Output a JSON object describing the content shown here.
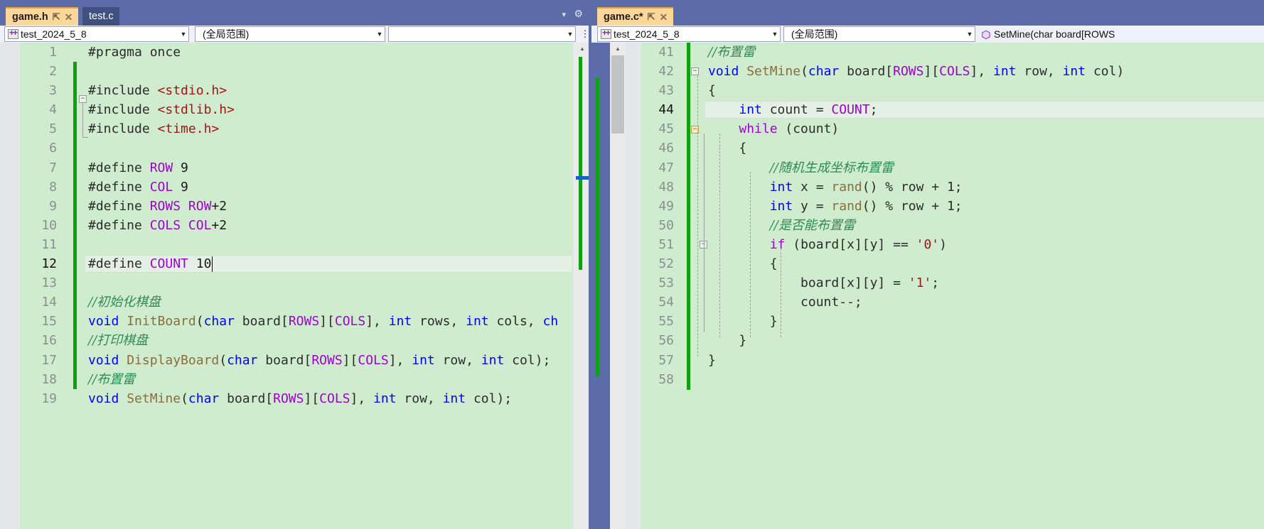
{
  "window": {
    "chrome_color": "#5b6ca8",
    "editor_bg": "#cfeccf",
    "accent_active_tab": "#fcd79a"
  },
  "left_panel": {
    "tabs": [
      {
        "label": "game.h",
        "active": true,
        "pin_icon": "pin-icon",
        "close_icon": "close-icon"
      },
      {
        "label": "test.c",
        "active": false,
        "pin_icon": "pin-icon",
        "close_icon": "close-icon"
      }
    ],
    "toolbar": {
      "project_combo": {
        "value": "test_2024_5_8",
        "icon": "project-icon",
        "arrow": "▾"
      },
      "scope_combo": {
        "value": "(全局范围)",
        "arrow": "▾"
      },
      "member_combo": {
        "value": "",
        "arrow": "▾"
      },
      "dropdown_icon": "chevron-down-icon",
      "settings_icon": "gear-icon",
      "split_icon": "split-icon"
    },
    "code": {
      "current_line": 12,
      "first_line": 1,
      "lines": [
        {
          "n": 1,
          "tokens": [
            {
              "t": "#pragma once",
              "c": "k-pre"
            }
          ]
        },
        {
          "n": 2,
          "tokens": []
        },
        {
          "n": 3,
          "tokens": [
            {
              "t": "#include ",
              "c": "k-pre"
            },
            {
              "t": "<stdio.h>",
              "c": "k-str"
            }
          ]
        },
        {
          "n": 4,
          "tokens": [
            {
              "t": "#include ",
              "c": "k-pre"
            },
            {
              "t": "<stdlib.h>",
              "c": "k-str"
            }
          ]
        },
        {
          "n": 5,
          "tokens": [
            {
              "t": "#include ",
              "c": "k-pre"
            },
            {
              "t": "<time.h>",
              "c": "k-str"
            }
          ]
        },
        {
          "n": 6,
          "tokens": []
        },
        {
          "n": 7,
          "tokens": [
            {
              "t": "#define ",
              "c": "k-pre"
            },
            {
              "t": "ROW",
              "c": "k-macro"
            },
            {
              "t": " 9",
              "c": "k-num"
            }
          ]
        },
        {
          "n": 8,
          "tokens": [
            {
              "t": "#define ",
              "c": "k-pre"
            },
            {
              "t": "COL",
              "c": "k-macro"
            },
            {
              "t": " 9",
              "c": "k-num"
            }
          ]
        },
        {
          "n": 9,
          "tokens": [
            {
              "t": "#define ",
              "c": "k-pre"
            },
            {
              "t": "ROWS ",
              "c": "k-macro"
            },
            {
              "t": "ROW",
              "c": "k-macro"
            },
            {
              "t": "+2",
              "c": "k-num"
            }
          ]
        },
        {
          "n": 10,
          "tokens": [
            {
              "t": "#define ",
              "c": "k-pre"
            },
            {
              "t": "COLS ",
              "c": "k-macro"
            },
            {
              "t": "COL",
              "c": "k-macro"
            },
            {
              "t": "+2",
              "c": "k-num"
            }
          ]
        },
        {
          "n": 11,
          "tokens": []
        },
        {
          "n": 12,
          "tokens": [
            {
              "t": "#define ",
              "c": "k-pre"
            },
            {
              "t": "COUNT",
              "c": "k-macro"
            },
            {
              "t": " 10",
              "c": "k-num"
            }
          ]
        },
        {
          "n": 13,
          "tokens": []
        },
        {
          "n": 14,
          "tokens": [
            {
              "t": "//初始化棋盘",
              "c": "k-com"
            }
          ]
        },
        {
          "n": 15,
          "tokens": [
            {
              "t": "void",
              "c": "k-kw"
            },
            {
              "t": " ",
              "c": "k-id"
            },
            {
              "t": "InitBoard",
              "c": "k-fn"
            },
            {
              "t": "(",
              "c": "k-id"
            },
            {
              "t": "char",
              "c": "k-kw"
            },
            {
              "t": " board[",
              "c": "k-id"
            },
            {
              "t": "ROWS",
              "c": "k-macro"
            },
            {
              "t": "][",
              "c": "k-id"
            },
            {
              "t": "COLS",
              "c": "k-macro"
            },
            {
              "t": "], ",
              "c": "k-id"
            },
            {
              "t": "int",
              "c": "k-kw"
            },
            {
              "t": " rows, ",
              "c": "k-id"
            },
            {
              "t": "int",
              "c": "k-kw"
            },
            {
              "t": " cols, ",
              "c": "k-id"
            },
            {
              "t": "ch",
              "c": "k-kw"
            }
          ]
        },
        {
          "n": 16,
          "tokens": [
            {
              "t": "//打印棋盘",
              "c": "k-com"
            }
          ]
        },
        {
          "n": 17,
          "tokens": [
            {
              "t": "void",
              "c": "k-kw"
            },
            {
              "t": " ",
              "c": "k-id"
            },
            {
              "t": "DisplayBoard",
              "c": "k-fn"
            },
            {
              "t": "(",
              "c": "k-id"
            },
            {
              "t": "char",
              "c": "k-kw"
            },
            {
              "t": " board[",
              "c": "k-id"
            },
            {
              "t": "ROWS",
              "c": "k-macro"
            },
            {
              "t": "][",
              "c": "k-id"
            },
            {
              "t": "COLS",
              "c": "k-macro"
            },
            {
              "t": "], ",
              "c": "k-id"
            },
            {
              "t": "int",
              "c": "k-kw"
            },
            {
              "t": " row, ",
              "c": "k-id"
            },
            {
              "t": "int",
              "c": "k-kw"
            },
            {
              "t": " col);",
              "c": "k-id"
            }
          ]
        },
        {
          "n": 18,
          "tokens": [
            {
              "t": "//布置雷",
              "c": "k-com"
            }
          ]
        },
        {
          "n": 19,
          "tokens": [
            {
              "t": "void",
              "c": "k-kw"
            },
            {
              "t": " ",
              "c": "k-id"
            },
            {
              "t": "SetMine",
              "c": "k-fn"
            },
            {
              "t": "(",
              "c": "k-id"
            },
            {
              "t": "char",
              "c": "k-kw"
            },
            {
              "t": " board[",
              "c": "k-id"
            },
            {
              "t": "ROWS",
              "c": "k-macro"
            },
            {
              "t": "][",
              "c": "k-id"
            },
            {
              "t": "COLS",
              "c": "k-macro"
            },
            {
              "t": "], ",
              "c": "k-id"
            },
            {
              "t": "int",
              "c": "k-kw"
            },
            {
              "t": " row, ",
              "c": "k-id"
            },
            {
              "t": "int",
              "c": "k-kw"
            },
            {
              "t": " col);",
              "c": "k-id"
            }
          ]
        }
      ]
    },
    "scrollbar": {
      "up_arrow": "▲",
      "down_arrow": "▼",
      "marker_color": "#1565c0"
    }
  },
  "right_panel": {
    "tabs": [
      {
        "label": "game.c*",
        "active": true,
        "pin_icon": "pin-icon",
        "close_icon": "close-icon"
      }
    ],
    "toolbar": {
      "project_combo": {
        "value": "test_2024_5_8",
        "icon": "project-icon",
        "arrow": "▾"
      },
      "scope_combo": {
        "value": "(全局范围)",
        "arrow": "▾"
      },
      "member_combo": {
        "value": "SetMine(char board[ROWS",
        "icon": "method-icon",
        "arrow": "▾"
      }
    },
    "code": {
      "current_line": 44,
      "first_line": 41,
      "lines": [
        {
          "n": 41,
          "tokens": [
            {
              "t": "//布置雷",
              "c": "k-com"
            }
          ]
        },
        {
          "n": 42,
          "tokens": [
            {
              "t": "void",
              "c": "k-kw"
            },
            {
              "t": " ",
              "c": "k-id"
            },
            {
              "t": "SetMine",
              "c": "k-fn"
            },
            {
              "t": "(",
              "c": "k-id"
            },
            {
              "t": "char",
              "c": "k-kw"
            },
            {
              "t": " board[",
              "c": "k-id"
            },
            {
              "t": "ROWS",
              "c": "k-macro"
            },
            {
              "t": "][",
              "c": "k-id"
            },
            {
              "t": "COLS",
              "c": "k-macro"
            },
            {
              "t": "], ",
              "c": "k-id"
            },
            {
              "t": "int",
              "c": "k-kw"
            },
            {
              "t": " row, ",
              "c": "k-id"
            },
            {
              "t": "int",
              "c": "k-kw"
            },
            {
              "t": " col)",
              "c": "k-id"
            }
          ]
        },
        {
          "n": 43,
          "tokens": [
            {
              "t": "{",
              "c": "k-id"
            }
          ]
        },
        {
          "n": 44,
          "tokens": [
            {
              "t": "    ",
              "c": "k-id"
            },
            {
              "t": "int",
              "c": "k-kw"
            },
            {
              "t": " count = ",
              "c": "k-id"
            },
            {
              "t": "COUNT",
              "c": "k-macro"
            },
            {
              "t": ";",
              "c": "k-id"
            }
          ]
        },
        {
          "n": 45,
          "tokens": [
            {
              "t": "    ",
              "c": "k-id"
            },
            {
              "t": "while",
              "c": "k-ctrl"
            },
            {
              "t": " (count)",
              "c": "k-id"
            }
          ]
        },
        {
          "n": 46,
          "tokens": [
            {
              "t": "    {",
              "c": "k-id"
            }
          ]
        },
        {
          "n": 47,
          "tokens": [
            {
              "t": "        ",
              "c": "k-id"
            },
            {
              "t": "//随机生成坐标布置雷",
              "c": "k-com"
            }
          ]
        },
        {
          "n": 48,
          "tokens": [
            {
              "t": "        ",
              "c": "k-id"
            },
            {
              "t": "int",
              "c": "k-kw"
            },
            {
              "t": " x = ",
              "c": "k-id"
            },
            {
              "t": "rand",
              "c": "k-fn"
            },
            {
              "t": "() % row + 1;",
              "c": "k-id"
            }
          ]
        },
        {
          "n": 49,
          "tokens": [
            {
              "t": "        ",
              "c": "k-id"
            },
            {
              "t": "int",
              "c": "k-kw"
            },
            {
              "t": " y = ",
              "c": "k-id"
            },
            {
              "t": "rand",
              "c": "k-fn"
            },
            {
              "t": "() % row + 1;",
              "c": "k-id"
            }
          ]
        },
        {
          "n": 50,
          "tokens": [
            {
              "t": "        ",
              "c": "k-id"
            },
            {
              "t": "//是否能布置雷",
              "c": "k-com"
            }
          ]
        },
        {
          "n": 51,
          "tokens": [
            {
              "t": "        ",
              "c": "k-id"
            },
            {
              "t": "if",
              "c": "k-ctrl"
            },
            {
              "t": " (board[x][y] == ",
              "c": "k-id"
            },
            {
              "t": "'0'",
              "c": "k-str"
            },
            {
              "t": ")",
              "c": "k-id"
            }
          ]
        },
        {
          "n": 52,
          "tokens": [
            {
              "t": "        {",
              "c": "k-id"
            }
          ]
        },
        {
          "n": 53,
          "tokens": [
            {
              "t": "            board[x][y] = ",
              "c": "k-id"
            },
            {
              "t": "'1'",
              "c": "k-str"
            },
            {
              "t": ";",
              "c": "k-id"
            }
          ]
        },
        {
          "n": 54,
          "tokens": [
            {
              "t": "            count--;",
              "c": "k-id"
            }
          ]
        },
        {
          "n": 55,
          "tokens": [
            {
              "t": "        }",
              "c": "k-id"
            }
          ]
        },
        {
          "n": 56,
          "tokens": [
            {
              "t": "    }",
              "c": "k-id"
            }
          ]
        },
        {
          "n": 57,
          "tokens": [
            {
              "t": "}",
              "c": "k-id"
            }
          ]
        },
        {
          "n": 58,
          "tokens": []
        }
      ]
    },
    "scrollbar": {
      "up_arrow": "▲",
      "down_arrow": "▼"
    }
  }
}
